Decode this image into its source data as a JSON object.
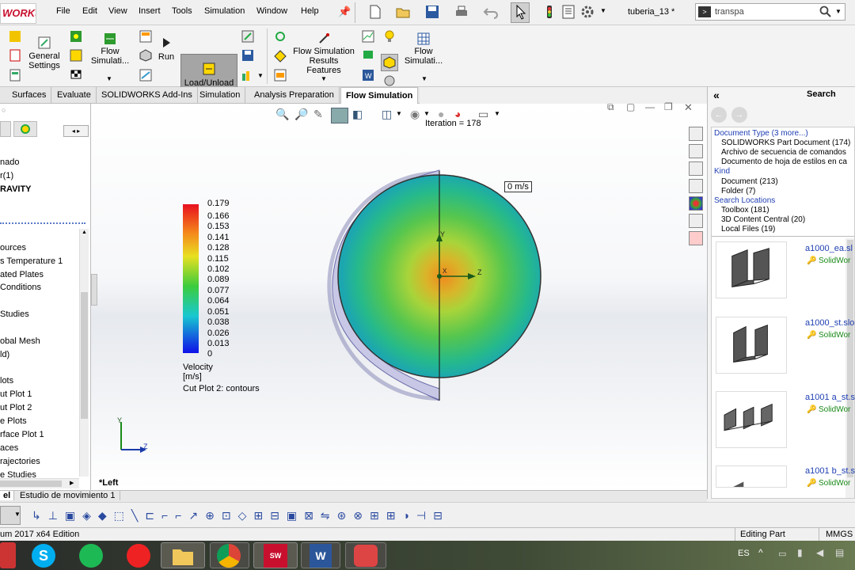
{
  "app": {
    "logo": "WORKS",
    "filename": "tuberia_13 *",
    "search_value": "transpa"
  },
  "menu": [
    "File",
    "Edit",
    "View",
    "Insert",
    "Tools",
    "Simulation",
    "Window",
    "Help"
  ],
  "command_manager": {
    "general_settings": "General\nSettings",
    "flow_simulation_1": "Flow\nSimulati...",
    "run": "Run",
    "load_unload": "Load/Unload",
    "fs_results_features": "Flow Simulation\nResults Features",
    "flow_simulation_2": "Flow\nSimulati..."
  },
  "tabs": [
    "Surfaces",
    "Evaluate",
    "SOLIDWORKS Add-Ins",
    "Simulation",
    "Analysis Preparation",
    "Flow Simulation"
  ],
  "active_tab": "Flow Simulation",
  "tree": {
    "top": [
      "nado",
      "r(1)",
      "RAVITY"
    ],
    "items": [
      "ources",
      "s Temperature 1",
      "ated Plates",
      "Conditions",
      "Studies",
      "obal Mesh",
      "ld)",
      "lots",
      "ut Plot 1",
      "ut Plot 2",
      "e Plots",
      "rface Plot 1",
      "aces",
      "rajectories",
      "e Studies"
    ]
  },
  "viewport": {
    "iteration": "Iteration = 178",
    "probe": "0 m/s",
    "view_name": "*Left",
    "cut_plot": "Cut Plot 2: contours",
    "triad_y": "Y",
    "triad_z": "Z"
  },
  "legend": {
    "title": "Velocity [m/s]",
    "values": [
      "0.179",
      "0.166",
      "0.153",
      "0.141",
      "0.128",
      "0.115",
      "0.102",
      "0.089",
      "0.077",
      "0.064",
      "0.051",
      "0.038",
      "0.026",
      "0.013",
      "0"
    ]
  },
  "search_panel": {
    "title": "Search",
    "groups": [
      {
        "header": "Document Type (3 more...)",
        "items": [
          "SOLIDWORKS Part Document (174)",
          "Archivo de secuencia de comandos",
          "Documento de hoja de estilos en ca"
        ]
      },
      {
        "header": "Kind",
        "items": [
          "Document (213)",
          "Folder (7)"
        ]
      },
      {
        "header": "Search Locations",
        "items": [
          "Toolbox (181)",
          "3D Content Central (20)",
          "Local Files (19)"
        ]
      }
    ],
    "results": [
      {
        "name": "a1000_ea.sl",
        "type": "SolidWor"
      },
      {
        "name": "a1000_st.slo",
        "type": "SolidWor"
      },
      {
        "name": "a1001 a_st.s",
        "type": "SolidWor"
      },
      {
        "name": "a1001 b_st.s",
        "type": "SolidWor"
      }
    ]
  },
  "bottom_tabs": [
    "el",
    "Estudio de movimiento 1"
  ],
  "status": {
    "edition": "um 2017 x64 Edition",
    "mode": "Editing Part",
    "units": "MMGS"
  },
  "taskbar": {
    "lang": "ES"
  },
  "colors": {
    "accent": "#1f3fb3",
    "active_tab": "#ffffff",
    "load_button": "#a5a5a5"
  }
}
